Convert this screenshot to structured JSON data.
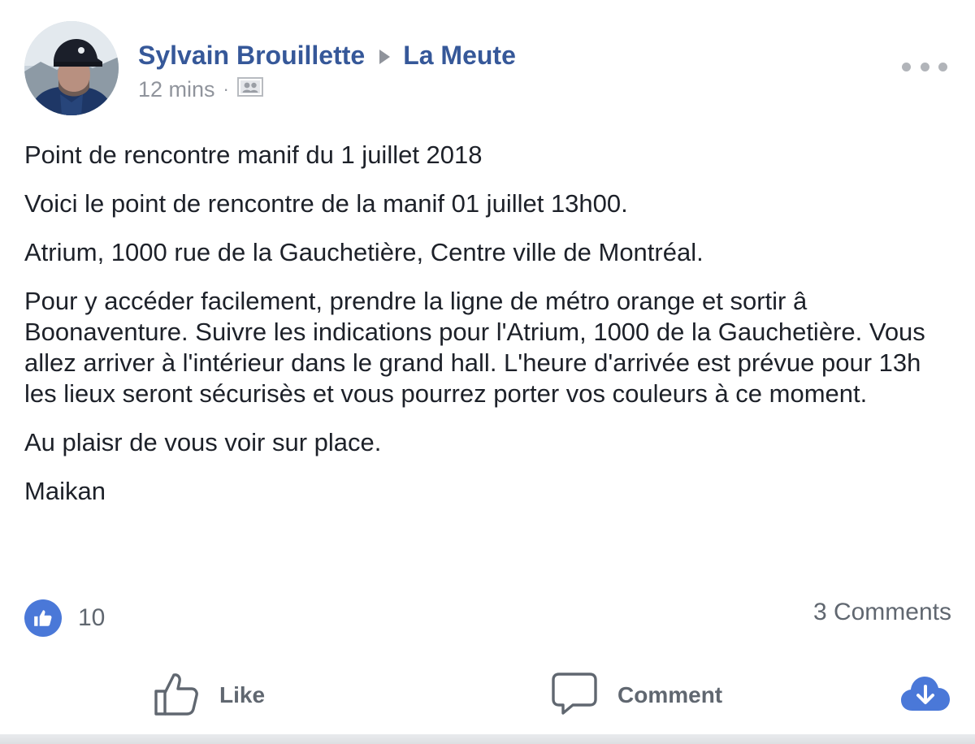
{
  "post": {
    "author": "Sylvain Brouillette",
    "group": "La Meute",
    "timestamp": "12 mins",
    "separator": "·",
    "audience_icon": "closed-group-icon",
    "more_icon": "ellipsis-icon",
    "avatar_icon": "profile-photo"
  },
  "content": {
    "paragraphs": [
      "Point de rencontre manif du 1 juillet 2018",
      "Voici le point de rencontre de la manif 01 juillet 13h00.",
      "Atrium, 1000 rue de la Gauchetière, Centre ville de Montréal.",
      "Pour y accéder facilement, prendre la ligne de métro orange et sortir â Boonaventure. Suivre les indications pour l'Atrium, 1000 de la Gauchetière. Vous allez arriver à l'intérieur dans le grand hall. L'heure d'arrivée est prévue pour 13h les lieux seront sécurisès et vous pourrez porter vos couleurs à ce moment.",
      "Au plaisr de vous voir sur place.",
      "Maikan"
    ]
  },
  "reactions": {
    "icon": "like-reaction-icon",
    "count": "10",
    "comments": "3 Comments"
  },
  "actions": {
    "like_label": "Like",
    "comment_label": "Comment",
    "like_icon": "thumbs-up-icon",
    "comment_icon": "speech-bubble-icon",
    "share_icon": "download-cloud-icon"
  },
  "colors": {
    "link_blue": "#365899",
    "like_blue": "#4a78d8",
    "text": "#1d2129",
    "muted": "#606770",
    "meta": "#90949c"
  }
}
